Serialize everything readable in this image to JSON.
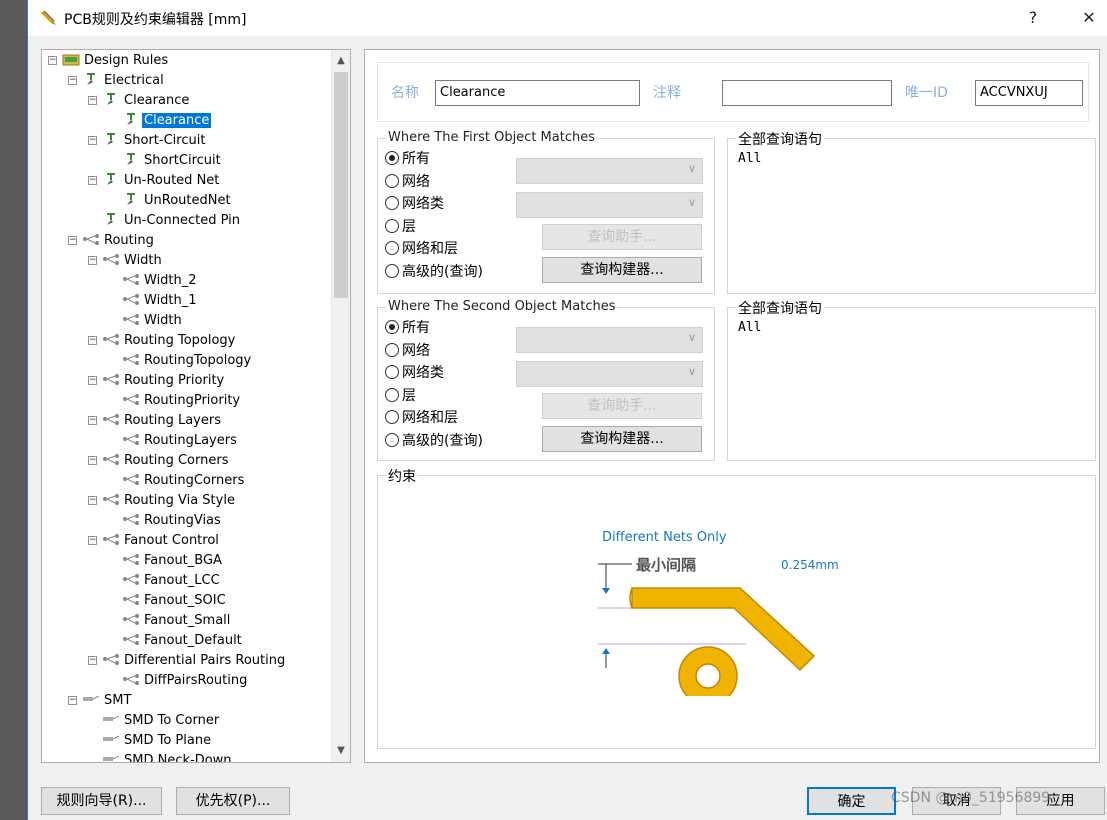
{
  "window": {
    "title": "PCB规则及约束编辑器 [mm]",
    "help_label": "?",
    "close_label": "✕"
  },
  "tree": {
    "items": [
      {
        "label": "Design Rules",
        "depth": 0,
        "expander": "−",
        "icon": "design-rules-icon"
      },
      {
        "label": "Electrical",
        "depth": 1,
        "expander": "−",
        "icon": "electrical-icon"
      },
      {
        "label": "Clearance",
        "depth": 2,
        "expander": "−",
        "icon": "clearance-category-icon"
      },
      {
        "label": "Clearance",
        "depth": 3,
        "expander": "",
        "icon": "clearance-rule-icon",
        "selected": true
      },
      {
        "label": "Short-Circuit",
        "depth": 2,
        "expander": "−",
        "icon": "short-circuit-icon"
      },
      {
        "label": "ShortCircuit",
        "depth": 3,
        "expander": "",
        "icon": "short-circuit-rule-icon"
      },
      {
        "label": "Un-Routed Net",
        "depth": 2,
        "expander": "−",
        "icon": "unrouted-net-icon"
      },
      {
        "label": "UnRoutedNet",
        "depth": 3,
        "expander": "",
        "icon": "unrouted-net-rule-icon"
      },
      {
        "label": "Un-Connected Pin",
        "depth": 2,
        "expander": "",
        "icon": "unconnected-pin-icon"
      },
      {
        "label": "Routing",
        "depth": 1,
        "expander": "−",
        "icon": "routing-icon"
      },
      {
        "label": "Width",
        "depth": 2,
        "expander": "−",
        "icon": "width-category-icon"
      },
      {
        "label": "Width_2",
        "depth": 3,
        "expander": "",
        "icon": "width-rule-icon"
      },
      {
        "label": "Width_1",
        "depth": 3,
        "expander": "",
        "icon": "width-rule-icon"
      },
      {
        "label": "Width",
        "depth": 3,
        "expander": "",
        "icon": "width-rule-icon"
      },
      {
        "label": "Routing Topology",
        "depth": 2,
        "expander": "−",
        "icon": "routing-topology-icon"
      },
      {
        "label": "RoutingTopology",
        "depth": 3,
        "expander": "",
        "icon": "routing-topology-rule-icon"
      },
      {
        "label": "Routing Priority",
        "depth": 2,
        "expander": "−",
        "icon": "routing-priority-icon"
      },
      {
        "label": "RoutingPriority",
        "depth": 3,
        "expander": "",
        "icon": "routing-priority-rule-icon"
      },
      {
        "label": "Routing Layers",
        "depth": 2,
        "expander": "−",
        "icon": "routing-layers-icon"
      },
      {
        "label": "RoutingLayers",
        "depth": 3,
        "expander": "",
        "icon": "routing-layers-rule-icon"
      },
      {
        "label": "Routing Corners",
        "depth": 2,
        "expander": "−",
        "icon": "routing-corners-icon"
      },
      {
        "label": "RoutingCorners",
        "depth": 3,
        "expander": "",
        "icon": "routing-corners-rule-icon"
      },
      {
        "label": "Routing Via Style",
        "depth": 2,
        "expander": "−",
        "icon": "routing-via-style-icon"
      },
      {
        "label": "RoutingVias",
        "depth": 3,
        "expander": "",
        "icon": "routing-vias-rule-icon"
      },
      {
        "label": "Fanout Control",
        "depth": 2,
        "expander": "−",
        "icon": "fanout-control-icon"
      },
      {
        "label": "Fanout_BGA",
        "depth": 3,
        "expander": "",
        "icon": "fanout-rule-icon"
      },
      {
        "label": "Fanout_LCC",
        "depth": 3,
        "expander": "",
        "icon": "fanout-rule-icon"
      },
      {
        "label": "Fanout_SOIC",
        "depth": 3,
        "expander": "",
        "icon": "fanout-rule-icon"
      },
      {
        "label": "Fanout_Small",
        "depth": 3,
        "expander": "",
        "icon": "fanout-rule-icon"
      },
      {
        "label": "Fanout_Default",
        "depth": 3,
        "expander": "",
        "icon": "fanout-rule-icon"
      },
      {
        "label": "Differential Pairs Routing",
        "depth": 2,
        "expander": "−",
        "icon": "diff-pairs-icon"
      },
      {
        "label": "DiffPairsRouting",
        "depth": 3,
        "expander": "",
        "icon": "diff-pairs-rule-icon"
      },
      {
        "label": "SMT",
        "depth": 1,
        "expander": "−",
        "icon": "smt-icon"
      },
      {
        "label": "SMD To Corner",
        "depth": 2,
        "expander": "",
        "icon": "smd-to-corner-icon"
      },
      {
        "label": "SMD To Plane",
        "depth": 2,
        "expander": "",
        "icon": "smd-to-plane-icon"
      },
      {
        "label": "SMD Neck-Down",
        "depth": 2,
        "expander": "",
        "icon": "smd-neck-down-icon"
      }
    ]
  },
  "rule": {
    "name_label": "名称",
    "name_value": "Clearance",
    "comment_label": "注释",
    "comment_value": "",
    "uid_label": "唯一ID",
    "uid_value": "ACCVNXUJ"
  },
  "first_match": {
    "title": "Where The First Object Matches",
    "options": [
      "所有",
      "网络",
      "网络类",
      "层",
      "网络和层",
      "高级的(查询)"
    ],
    "selected_index": 0,
    "query_helper_label": "查询助手...",
    "query_builder_label": "查询构建器...",
    "query_title": "全部查询语句",
    "query_text": "All"
  },
  "second_match": {
    "title": "Where The Second Object Matches",
    "options": [
      "所有",
      "网络",
      "网络类",
      "层",
      "网络和层",
      "高级的(查询)"
    ],
    "selected_index": 0,
    "query_helper_label": "查询助手...",
    "query_builder_label": "查询构建器...",
    "query_title": "全部查询语句",
    "query_text": "All"
  },
  "constraints": {
    "title": "约束",
    "mode_label": "Different Nets Only",
    "min_clearance_label": "最小间隔",
    "min_clearance_value": "0.254mm",
    "colors": {
      "trace": "#f0b400",
      "trace_edge": "#c08a00",
      "link": "#1a73c9"
    }
  },
  "footer": {
    "rule_wizard_label": "规则向导(R)...",
    "priority_label": "优先权(P)...",
    "ok_label": "确定",
    "cancel_label": "取消",
    "apply_label": "应用",
    "watermark": "CSDN @m0_51956899"
  }
}
